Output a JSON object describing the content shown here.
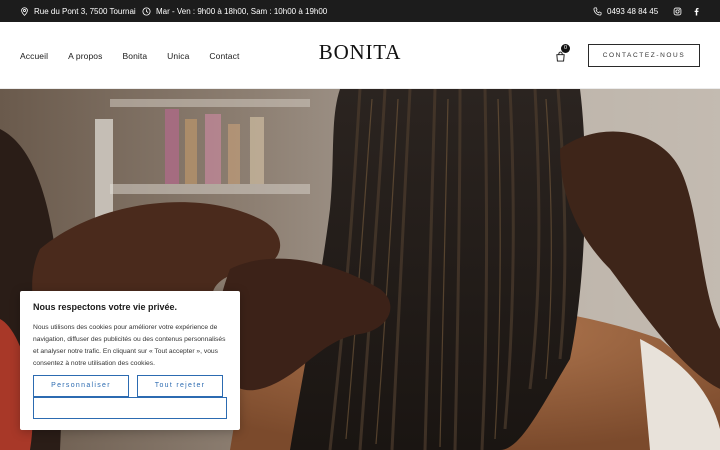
{
  "topbar": {
    "address": "Rue du Pont 3, 7500 Tournai",
    "hours": "Mar - Ven : 9h00 à 18h00, Sam : 10h00 à 19h00",
    "phone": "0493 48 84 45",
    "icons": [
      "map-pin-icon",
      "clock-icon",
      "phone-icon",
      "instagram-icon",
      "facebook-icon"
    ]
  },
  "nav": {
    "items": [
      "Accueil",
      "A propos",
      "Bonita",
      "Unica",
      "Contact"
    ]
  },
  "logo": "BONITA",
  "cart": {
    "count": "0",
    "icon": "shopping-bag-icon"
  },
  "contact_button": "CONTACTEZ-NOUS",
  "cookie": {
    "title": "Nous respectons votre vie privée.",
    "body": "Nous utilisons des cookies pour améliorer votre expérience de navigation, diffuser des publicités ou des contenus personnalisés et analyser notre trafic. En cliquant sur « Tout accepter », vous consentez à notre utilisation des cookies.",
    "customize_label": "Personnaliser",
    "reject_label": "Tout rejeter",
    "accept_label": ""
  },
  "colors": {
    "topbar_bg": "#1c1c1c",
    "cookie_button": "#2c6bb1"
  }
}
